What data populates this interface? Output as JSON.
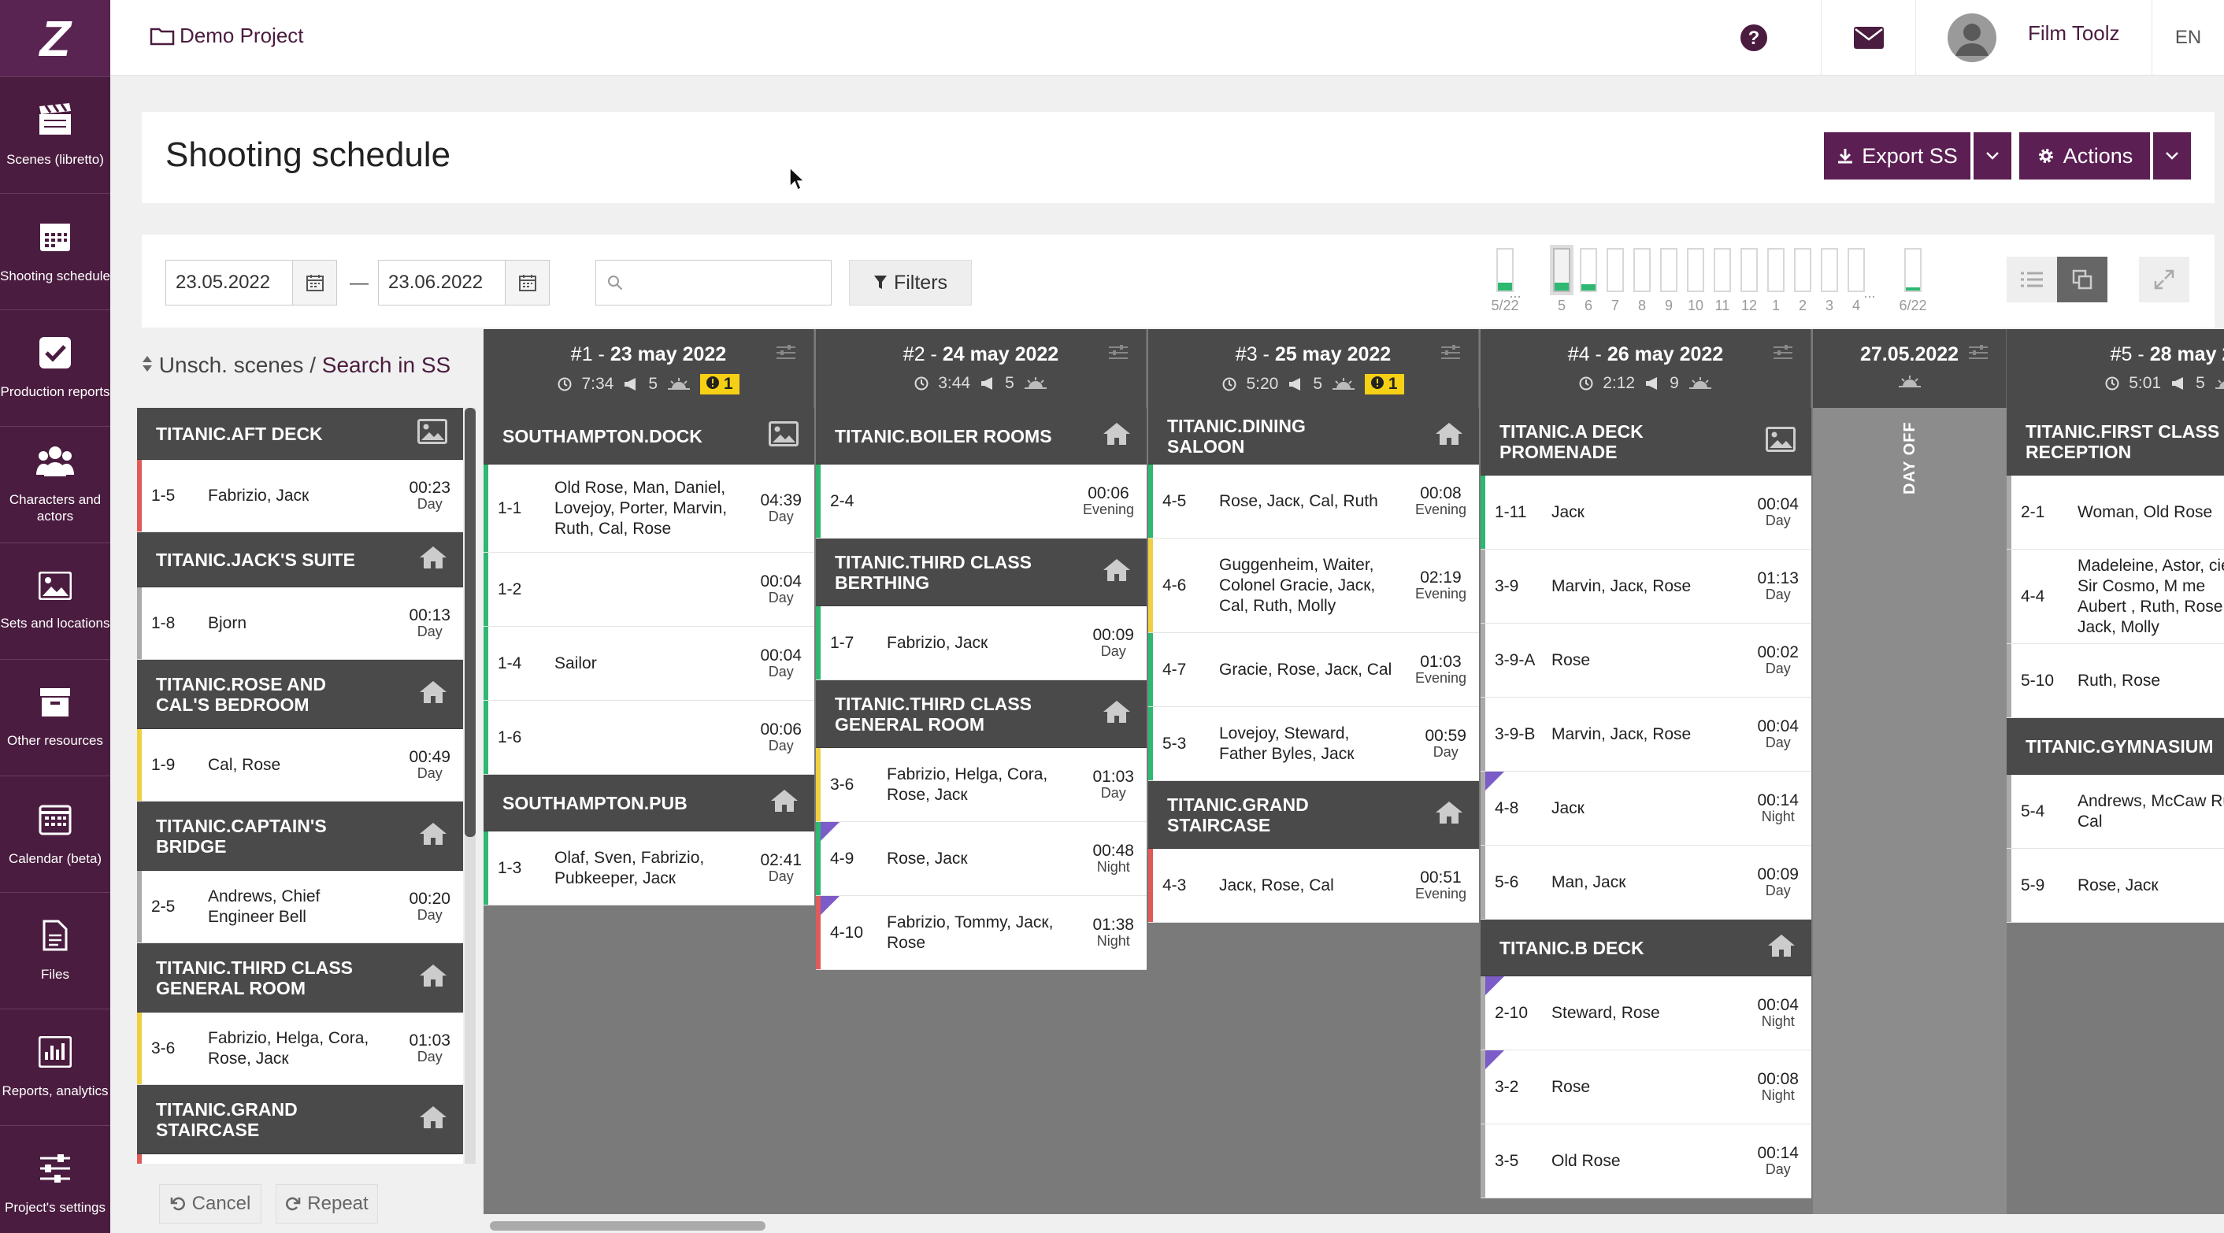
{
  "app": {
    "logo": "Z",
    "project": "Demo Project",
    "user": "Film Toolz",
    "lang": "EN"
  },
  "nav": [
    {
      "label": "Scenes (libretto)",
      "icon": "clapperboard-icon"
    },
    {
      "label": "Shooting schedule",
      "icon": "calendar-icon"
    },
    {
      "label": "Production reports",
      "icon": "checkbox-icon"
    },
    {
      "label": "Characters and actors",
      "icon": "users-icon"
    },
    {
      "label": "Sets and locations",
      "icon": "image-icon"
    },
    {
      "label": "Other resources",
      "icon": "archive-icon"
    },
    {
      "label": "Calendar (beta)",
      "icon": "calendar-grid-icon"
    },
    {
      "label": "Files",
      "icon": "file-icon"
    },
    {
      "label": "Reports, analytics",
      "icon": "chart-icon"
    },
    {
      "label": "Project's settings",
      "icon": "sliders-icon"
    }
  ],
  "page": {
    "title": "Shooting schedule",
    "export_label": "Export SS",
    "actions_label": "Actions"
  },
  "filters": {
    "date_from": "23.05.2022",
    "date_sep": "—",
    "date_to": "23.06.2022",
    "search_placeholder": "",
    "filters_label": "Filters"
  },
  "mini_days": [
    {
      "label": "5/22",
      "fill": 0.2
    },
    {
      "label": "5",
      "fill": 0.2,
      "selected": true
    },
    {
      "label": "6",
      "fill": 0.15
    },
    {
      "label": "7",
      "fill": 0
    },
    {
      "label": "8",
      "fill": 0
    },
    {
      "label": "9",
      "fill": 0
    },
    {
      "label": "10",
      "fill": 0
    },
    {
      "label": "11",
      "fill": 0
    },
    {
      "label": "12",
      "fill": 0
    },
    {
      "label": "1",
      "fill": 0
    },
    {
      "label": "2",
      "fill": 0
    },
    {
      "label": "3",
      "fill": 0
    },
    {
      "label": "4",
      "fill": 0
    },
    {
      "label": "6/22",
      "fill": 0.08
    }
  ],
  "mini_ellipsis": "...",
  "unscheduled": {
    "label": "Unsch. scenes",
    "sep": " / ",
    "link": "Search in SS"
  },
  "left_list": [
    {
      "type": "loc",
      "name": "TITANIC.AFT DECK",
      "icon": "image-icon",
      "h": 66
    },
    {
      "type": "scene",
      "num": "1-5",
      "chars": "Fabrizio, Jacк",
      "time": "00:23",
      "tod": "Day",
      "color": "#e05a5a",
      "h": 92
    },
    {
      "type": "loc",
      "name": "TITANIC.JACK'S SUITE",
      "icon": "home-icon",
      "h": 70
    },
    {
      "type": "scene",
      "num": "1-8",
      "chars": "Bjorn",
      "time": "00:13",
      "tod": "Day",
      "color": "#aaaaaa",
      "h": 92
    },
    {
      "type": "loc",
      "name": "TITANIC.ROSE AND CAL'S BEDROOM",
      "icon": "home-icon",
      "h": 88
    },
    {
      "type": "scene",
      "num": "1-9",
      "chars": "Cal, Rose",
      "time": "00:49",
      "tod": "Day",
      "color": "#f0d040",
      "h": 92
    },
    {
      "type": "loc",
      "name": "TITANIC.CAPTAIN'S BRIDGE",
      "icon": "home-icon",
      "h": 88
    },
    {
      "type": "scene",
      "num": "2-5",
      "chars": "Andrews, Chief Engineer Bell",
      "time": "00:20",
      "tod": "Day",
      "color": "#aaaaaa",
      "h": 92
    },
    {
      "type": "loc",
      "name": "TITANIC.THIRD CLASS GENERAL ROOM",
      "icon": "home-icon",
      "h": 88
    },
    {
      "type": "scene",
      "num": "3-6",
      "chars": "Fabrizio, Helga, Cora, Rose, Jacк",
      "time": "01:03",
      "tod": "Day",
      "color": "#f0d040",
      "h": 92
    },
    {
      "type": "loc",
      "name": "TITANIC.GRAND STAIRCASE",
      "icon": "home-icon",
      "h": 88
    },
    {
      "type": "scene",
      "num": "",
      "chars": "",
      "time": "",
      "tod": "",
      "color": "#e05a5a",
      "h": 92
    }
  ],
  "bottom": {
    "cancel": "Cancel",
    "repeat": "Repeat"
  },
  "days": [
    {
      "id": "#1",
      "date": "23 may 2022",
      "dur": "7:34",
      "pages": "5",
      "warn": "1",
      "items": [
        {
          "type": "loc",
          "name": "SOUTHAMPTON.DOCK",
          "icon": "image-icon",
          "h": 72
        },
        {
          "type": "scene",
          "num": "1-1",
          "chars": "Old Rose, Man, Daniel, Lovejoy, Porter, Marvin, Ruth, Cal, Rose",
          "time": "04:39",
          "tod": "Day",
          "color": "#2eb872",
          "h": 112
        },
        {
          "type": "scene",
          "num": "1-2",
          "chars": "",
          "time": "00:04",
          "tod": "Day",
          "color": "#2eb872",
          "h": 94
        },
        {
          "type": "scene",
          "num": "1-4",
          "chars": "Sailor",
          "time": "00:04",
          "tod": "Day",
          "color": "#2eb872",
          "h": 94
        },
        {
          "type": "scene",
          "num": "1-6",
          "chars": "",
          "time": "00:06",
          "tod": "Day",
          "color": "#2eb872",
          "h": 94
        },
        {
          "type": "loc",
          "name": "SOUTHAMPTON.PUB",
          "icon": "home-icon",
          "h": 72
        },
        {
          "type": "scene",
          "num": "1-3",
          "chars": "Olaf, Sven, Fabrizio, Pubkeeper, Jacк",
          "time": "02:41",
          "tod": "Day",
          "color": "#2eb872",
          "h": 94
        }
      ]
    },
    {
      "id": "#2",
      "date": "24 may 2022",
      "dur": "3:44",
      "pages": "5",
      "warn": "",
      "items": [
        {
          "type": "loc",
          "name": "TITANIC.BOILER ROOMS",
          "icon": "home-icon",
          "h": 72
        },
        {
          "type": "scene",
          "num": "2-4",
          "chars": "",
          "time": "00:06",
          "tod": "Evening",
          "color": "#2eb872",
          "h": 94
        },
        {
          "type": "loc",
          "name": "TITANIC.THIRD CLASS BERTHING",
          "icon": "home-icon",
          "h": 86
        },
        {
          "type": "scene",
          "num": "1-7",
          "chars": "Fabrizio, Jacк",
          "time": "00:09",
          "tod": "Day",
          "color": "#2eb872",
          "h": 94
        },
        {
          "type": "loc",
          "name": "TITANIC.THIRD CLASS GENERAL ROOM",
          "icon": "home-icon",
          "h": 86
        },
        {
          "type": "scene",
          "num": "3-6",
          "chars": "Fabrizio, Helga, Cora, Rose, Jacк",
          "time": "01:03",
          "tod": "Day",
          "color": "#f0d040",
          "h": 94
        },
        {
          "type": "scene",
          "num": "4-9",
          "chars": "Rose, Jacк",
          "time": "00:48",
          "tod": "Night",
          "color": "#2eb872",
          "night": true,
          "h": 94
        },
        {
          "type": "scene",
          "num": "4-10",
          "chars": "Fabrizio, Tommy, Jacк, Rose",
          "time": "01:38",
          "tod": "Night",
          "color": "#e05a5a",
          "night": true,
          "h": 94
        }
      ]
    },
    {
      "id": "#3",
      "date": "25 may 2022",
      "dur": "5:20",
      "pages": "5",
      "warn": "1",
      "items": [
        {
          "type": "loc",
          "name": "TITANIC.DINING SALOON",
          "icon": "home-icon",
          "h": 72
        },
        {
          "type": "scene",
          "num": "4-5",
          "chars": "Rose, Jacк, Cal, Ruth",
          "time": "00:08",
          "tod": "Evening",
          "color": "#2eb872",
          "h": 94
        },
        {
          "type": "scene",
          "num": "4-6",
          "chars": "Guggenheim, Waiter, Colonel Gracie, Jacк, Cal, Ruth, Molly",
          "time": "02:19",
          "tod": "Evening",
          "color": "#f0d040",
          "h": 120
        },
        {
          "type": "scene",
          "num": "4-7",
          "chars": "Gracie, Rose, Jacк, Cal",
          "time": "01:03",
          "tod": "Evening",
          "color": "#2eb872",
          "h": 94
        },
        {
          "type": "scene",
          "num": "5-3",
          "chars": "Lovejoy, Steward, Father Byles, Jacк",
          "time": "00:59",
          "tod": "Day",
          "color": "#2eb872",
          "h": 94
        },
        {
          "type": "loc",
          "name": "TITANIC.GRAND STAIRCASE",
          "icon": "home-icon",
          "h": 86
        },
        {
          "type": "scene",
          "num": "4-3",
          "chars": "Jacк, Rose, Cal",
          "time": "00:51",
          "tod": "Evening",
          "color": "#e05a5a",
          "h": 94
        }
      ]
    },
    {
      "id": "#4",
      "date": "26 may 2022",
      "dur": "2:12",
      "pages": "9",
      "warn": "",
      "items": [
        {
          "type": "loc",
          "name": "TITANIC.A DECK PROMENADE",
          "icon": "image-icon",
          "h": 86
        },
        {
          "type": "scene",
          "num": "1-11",
          "chars": "Jacк",
          "time": "00:04",
          "tod": "Day",
          "color": "#2eb872",
          "h": 94
        },
        {
          "type": "scene",
          "num": "3-9",
          "chars": "Marvin, Jacк, Rose",
          "time": "01:13",
          "tod": "Day",
          "color": "#aaaaaa",
          "h": 94
        },
        {
          "type": "scene",
          "num": "3-9-A",
          "chars": "Rose",
          "time": "00:02",
          "tod": "Day",
          "color": "#aaaaaa",
          "h": 94
        },
        {
          "type": "scene",
          "num": "3-9-B",
          "chars": "Marvin, Jacк, Rose",
          "time": "00:04",
          "tod": "Day",
          "color": "#aaaaaa",
          "h": 94
        },
        {
          "type": "scene",
          "num": "4-8",
          "chars": "Jacк",
          "time": "00:14",
          "tod": "Night",
          "color": "#aaaaaa",
          "night": true,
          "h": 94
        },
        {
          "type": "scene",
          "num": "5-6",
          "chars": "Man, Jacк",
          "time": "00:09",
          "tod": "Day",
          "color": "#aaaaaa",
          "h": 94
        },
        {
          "type": "loc",
          "name": "TITANIC.B DECK",
          "icon": "home-icon",
          "h": 72
        },
        {
          "type": "scene",
          "num": "2-10",
          "chars": "Steward, Rose",
          "time": "00:04",
          "tod": "Night",
          "color": "#aaaaaa",
          "night": true,
          "h": 94
        },
        {
          "type": "scene",
          "num": "3-2",
          "chars": "Rose",
          "time": "00:08",
          "tod": "Night",
          "color": "#aaaaaa",
          "night": true,
          "h": 94
        },
        {
          "type": "scene",
          "num": "3-5",
          "chars": "Old Rose",
          "time": "00:14",
          "tod": "Day",
          "color": "#aaaaaa",
          "h": 94
        }
      ]
    },
    {
      "id": "",
      "date": "27.05.2022",
      "dayoff": true,
      "dayoff_label": "DAY OFF"
    },
    {
      "id": "#5",
      "date": "28 may 2",
      "dur": "5:01",
      "pages": "5",
      "warn": "",
      "items": [
        {
          "type": "loc",
          "name": "TITANIC.FIRST CLASS RECEPTION",
          "icon": "home-icon",
          "h": 86
        },
        {
          "type": "scene",
          "num": "2-1",
          "chars": "Woman, Old Rose",
          "time": "",
          "tod": "",
          "color": "#aaaaaa",
          "h": 94
        },
        {
          "type": "scene",
          "num": "4-4",
          "chars": "Madeleine, Astor, cie, Sir Cosmo, M me Aubert , Ruth, Rose, Jack, Molly",
          "time": "",
          "tod": "",
          "color": "#aaaaaa",
          "h": 120
        },
        {
          "type": "scene",
          "num": "5-10",
          "chars": "Ruth, Rose",
          "time": "",
          "tod": "",
          "color": "#aaaaaa",
          "h": 94
        },
        {
          "type": "loc",
          "name": "TITANIC.GYMNASIUM",
          "icon": "",
          "h": 72
        },
        {
          "type": "scene",
          "num": "5-4",
          "chars": "Andrews, McCaw Ruth, Cal",
          "time": "",
          "tod": "",
          "color": "#aaaaaa",
          "h": 94
        },
        {
          "type": "scene",
          "num": "5-9",
          "chars": "Rose, Jacк",
          "time": "",
          "tod": "",
          "color": "#aaaaaa",
          "h": 94
        }
      ]
    }
  ]
}
